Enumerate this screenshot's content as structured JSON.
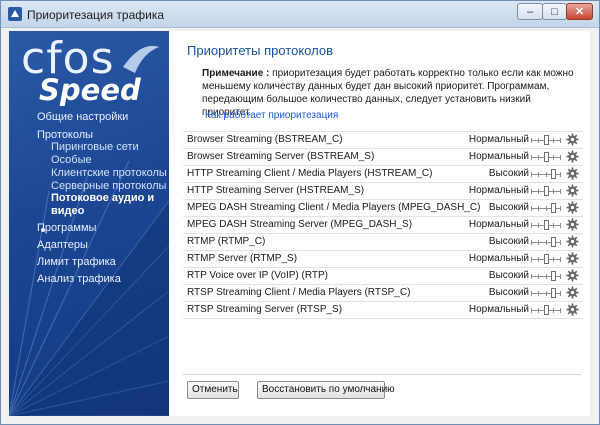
{
  "window": {
    "title": "Приоритезация трафика"
  },
  "titlebar": {
    "min_glyph": "–",
    "max_glyph": "□",
    "close_glyph": "✕"
  },
  "logo": {
    "line1": "cfos",
    "line2": "Speed"
  },
  "nav": {
    "general": "Общие настройки",
    "protocols": "Протоколы",
    "sub": {
      "p2p": "Пиринговые сети",
      "special": "Особые",
      "client": "Клиентские протоколы",
      "server": "Серверные протоколы",
      "streaming_1": "Потоковое аудио и",
      "streaming_2": "видео"
    },
    "programs": "Программы",
    "adapters": "Адаптеры",
    "traffic_limit": "Лимит трафика",
    "traffic_analysis": "Анализ трафика"
  },
  "main": {
    "title": "Приоритеты протоколов",
    "note_label": "Примечание :",
    "note_text": " приоритезация будет работать корректно только если как можно меньшему количеству данных будет дан высокий приоритет. Программам, передающим большое количество данных, следует установить низкий приоритет.",
    "how_link": "Как работает приоритезация"
  },
  "protocols": [
    {
      "name": "Browser Streaming (BSTREAM_C)",
      "priority": "Нормальный",
      "level": 2
    },
    {
      "name": "Browser Streaming Server (BSTREAM_S)",
      "priority": "Нормальный",
      "level": 2
    },
    {
      "name": "HTTP Streaming Client / Media Players (HSTREAM_C)",
      "priority": "Высокий",
      "level": 3
    },
    {
      "name": "HTTP Streaming Server (HSTREAM_S)",
      "priority": "Нормальный",
      "level": 2
    },
    {
      "name": "MPEG DASH Streaming Client / Media Players (MPEG_DASH_C)",
      "priority": "Высокий",
      "level": 3
    },
    {
      "name": "MPEG DASH Streaming Server (MPEG_DASH_S)",
      "priority": "Нормальный",
      "level": 2
    },
    {
      "name": "RTMP (RTMP_C)",
      "priority": "Высокий",
      "level": 3
    },
    {
      "name": "RTMP Server (RTMP_S)",
      "priority": "Нормальный",
      "level": 2
    },
    {
      "name": "RTP Voice over IP (VoIP) (RTP)",
      "priority": "Высокий",
      "level": 3
    },
    {
      "name": "RTSP Streaming Client / Media Players (RTSP_C)",
      "priority": "Высокий",
      "level": 3
    },
    {
      "name": "RTSP Streaming Server (RTSP_S)",
      "priority": "Нормальный",
      "level": 2
    }
  ],
  "buttons": {
    "cancel": "Отменить",
    "restore": "Восстановить по умолчанию"
  },
  "colors": {
    "sidebar": "#1c4693",
    "title": "#1b4f9c",
    "link": "#1a5ad0"
  },
  "icons": {
    "app": "traffic-app-icon",
    "gear": "gear-icon"
  }
}
